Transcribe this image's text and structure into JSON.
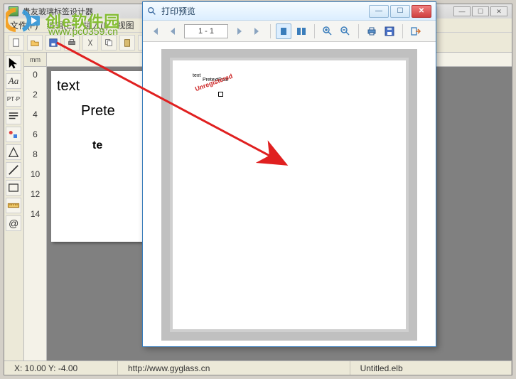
{
  "main": {
    "title": "贵友玻璃标签设计器",
    "menu": {
      "file": "文件(F)",
      "edit": "编辑(E)",
      "insert": "插入(I)",
      "view": "视图"
    },
    "ruler_unit": "mm",
    "ruler_v": [
      "0",
      "2",
      "4",
      "6",
      "8",
      "10",
      "12",
      "14"
    ],
    "doc": {
      "t1": "text",
      "t2": "Prete",
      "t3": "te"
    },
    "status": {
      "coords": "X: 10.00  Y: -4.00",
      "url": "http://www.gyglass.cn",
      "file": "Untitled.elb"
    }
  },
  "preview": {
    "title": "打印预览",
    "page_range": "1 - 1",
    "mini": {
      "l1": "text",
      "l2": "PretextPost"
    },
    "watermark": "Unregistered"
  },
  "overlay": {
    "site_name": "创e软件园",
    "site_url": "www.pc0359.cn"
  },
  "icons": {
    "arrow": "arrow-icon",
    "text": "text-icon",
    "ptp": "ptp-icon",
    "para": "paragraph-icon",
    "bezier": "bezier-icon",
    "poly": "polygon-icon",
    "box": "rectangle-icon",
    "ruler": "ruler-icon",
    "at": "at-icon",
    "first": "first-page-icon",
    "prev": "prev-page-icon",
    "next": "next-page-icon",
    "last": "last-page-icon",
    "single": "single-page-icon",
    "full": "full-width-icon",
    "zoomin": "zoom-in-icon",
    "zoomout": "zoom-out-icon",
    "print": "print-icon",
    "save": "save-icon",
    "exit": "exit-icon",
    "magnifier": "magnifier-icon"
  }
}
